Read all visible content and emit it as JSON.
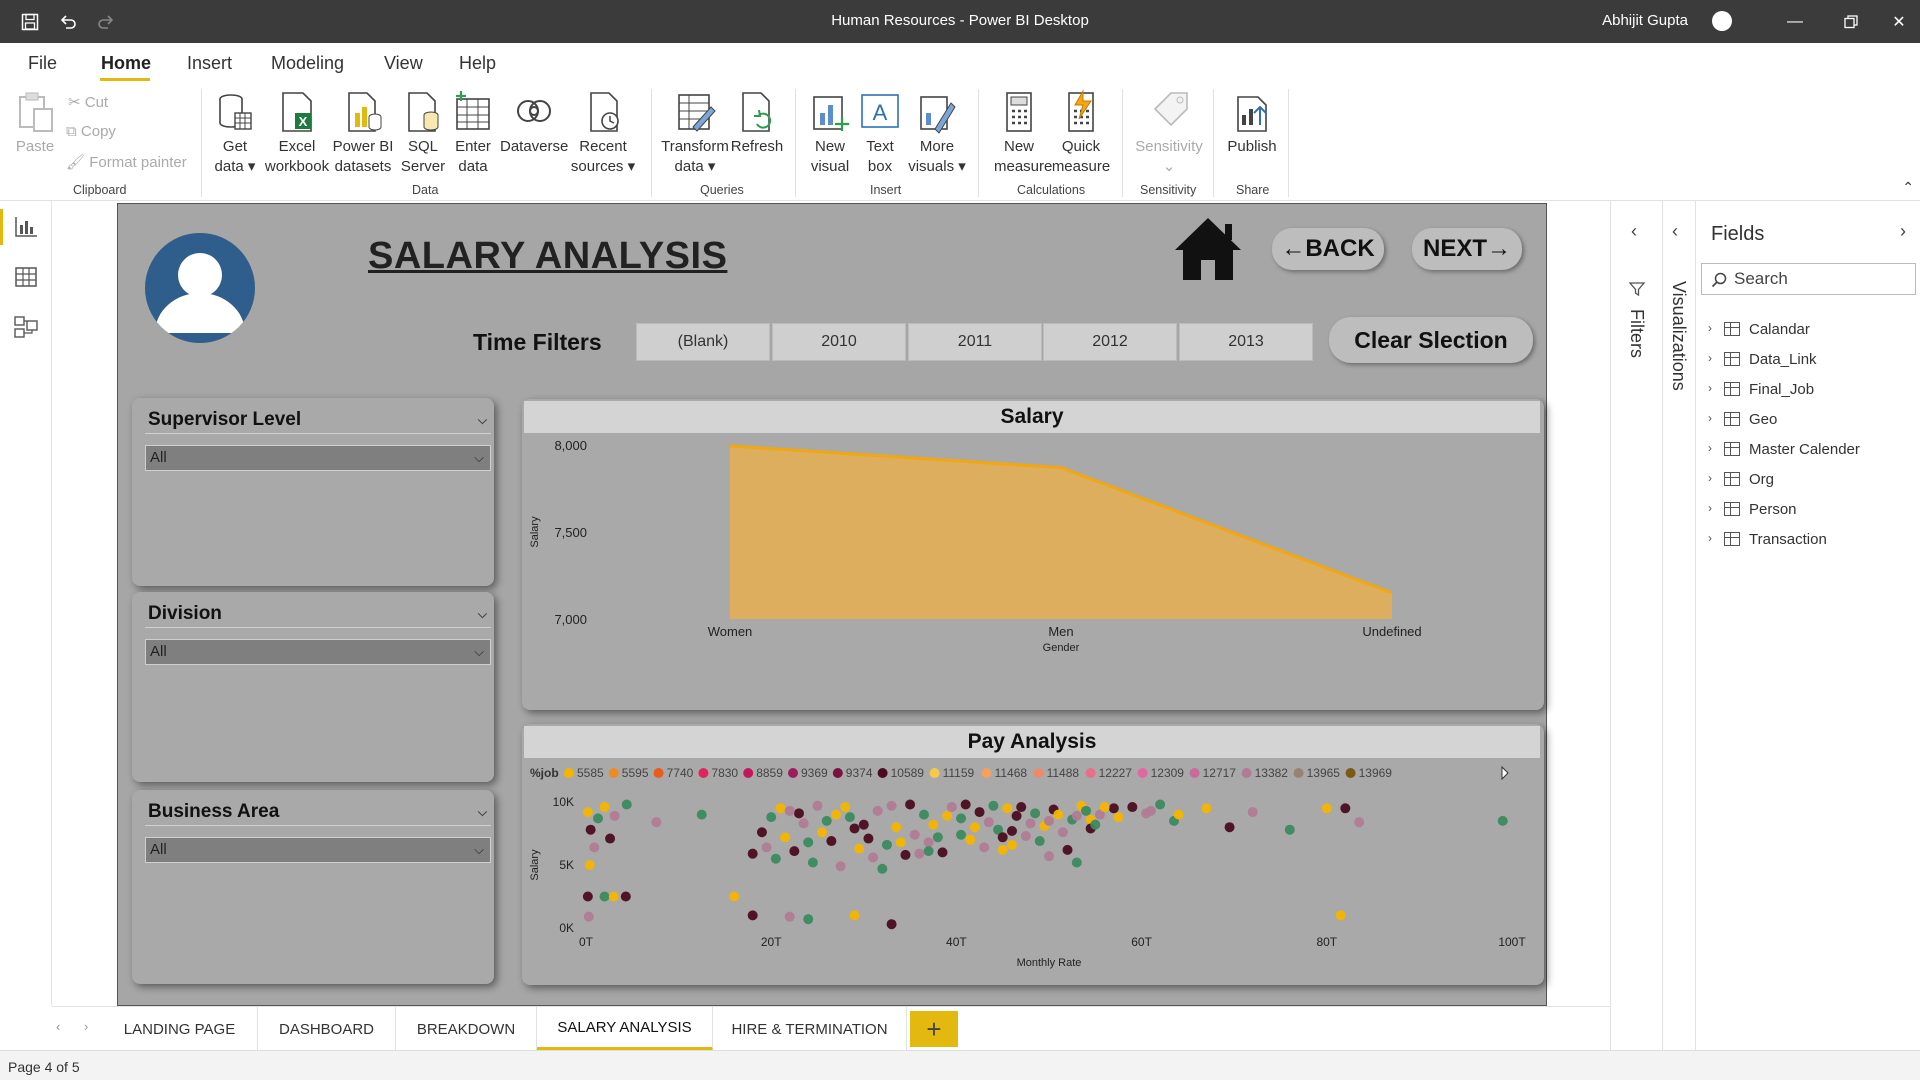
{
  "window": {
    "title": "Human Resources - Power BI Desktop",
    "user": "Abhijit Gupta"
  },
  "menu": [
    "File",
    "Home",
    "Insert",
    "Modeling",
    "View",
    "Help"
  ],
  "ribbon": {
    "clipboard": {
      "paste": "Paste",
      "cut": "Cut",
      "copy": "Copy",
      "format_painter": "Format painter",
      "label": "Clipboard"
    },
    "data": {
      "get_data": [
        "Get",
        "data ▾"
      ],
      "excel": [
        "Excel",
        "workbook"
      ],
      "pbi_datasets": [
        "Power BI",
        "datasets"
      ],
      "sql": [
        "SQL",
        "Server"
      ],
      "enter": [
        "Enter",
        "data"
      ],
      "dataverse": [
        "Dataverse",
        ""
      ],
      "recent": [
        "Recent",
        "sources ▾"
      ],
      "label": "Data"
    },
    "queries": {
      "transform": [
        "Transform",
        "data ▾"
      ],
      "refresh": [
        "Refresh",
        ""
      ],
      "label": "Queries"
    },
    "insert": {
      "new_visual": [
        "New",
        "visual"
      ],
      "text_box": [
        "Text",
        "box"
      ],
      "more_visuals": [
        "More",
        "visuals ▾"
      ],
      "label": "Insert"
    },
    "calculations": {
      "new_measure": [
        "New",
        "measure"
      ],
      "quick_measure": [
        "Quick",
        "measure"
      ],
      "label": "Calculations"
    },
    "sensitivity": {
      "btn": [
        "Sensitivity",
        "⌄"
      ],
      "label": "Sensitivity"
    },
    "share": {
      "publish": [
        "Publish",
        ""
      ],
      "label": "Share"
    }
  },
  "report": {
    "title": "SALARY ANALYSIS",
    "back": "←BACK",
    "next": "NEXT→",
    "time_filters_label": "Time Filters",
    "time_filters": [
      "(Blank)",
      "2010",
      "2011",
      "2012",
      "2013"
    ],
    "clear": "Clear Slection",
    "slicers": [
      {
        "title": "Supervisor Level",
        "value": "All"
      },
      {
        "title": "Division",
        "value": "All"
      },
      {
        "title": "Business Area",
        "value": "All"
      }
    ]
  },
  "chart_data": [
    {
      "type": "area",
      "title": "Salary",
      "categories": [
        "Women",
        "Men",
        "Undefined"
      ],
      "values": [
        7995,
        7870,
        7150
      ],
      "xlabel": "Gender",
      "ylabel": "Salary",
      "ylim": [
        7000,
        8000
      ],
      "yticks": [
        "8,000",
        "7,500",
        "7,000"
      ],
      "color": "#f2a711",
      "fill": "#dcae5e"
    },
    {
      "type": "scatter",
      "title": "Pay Analysis",
      "legend_title": "%job",
      "legend": [
        {
          "name": "5585",
          "color": "#f4b400"
        },
        {
          "name": "5595",
          "color": "#f08a24"
        },
        {
          "name": "7740",
          "color": "#e85d1c"
        },
        {
          "name": "7830",
          "color": "#e0245e"
        },
        {
          "name": "8859",
          "color": "#c2185b"
        },
        {
          "name": "9369",
          "color": "#9c1d5a"
        },
        {
          "name": "9374",
          "color": "#7a1240"
        },
        {
          "name": "10589",
          "color": "#4a0d1f"
        },
        {
          "name": "11159",
          "color": "#f7c94a"
        },
        {
          "name": "11468",
          "color": "#f2a25c"
        },
        {
          "name": "11488",
          "color": "#ee8a6a"
        },
        {
          "name": "12227",
          "color": "#e66f8a"
        },
        {
          "name": "12309",
          "color": "#e06aa0"
        },
        {
          "name": "12717",
          "color": "#c96a9b"
        },
        {
          "name": "13382",
          "color": "#b07b94"
        },
        {
          "name": "13965",
          "color": "#9a8272"
        },
        {
          "name": "13969",
          "color": "#7a5a14"
        }
      ],
      "xlabel": "Monthly Rate",
      "ylabel": "Salary",
      "xlim": [
        0,
        100
      ],
      "ylim": [
        0,
        10
      ],
      "xticks": [
        "0T",
        "20T",
        "40T",
        "60T",
        "80T",
        "100T"
      ],
      "yticks": [
        "10K",
        "5K",
        "0K"
      ],
      "points": [
        [
          0.2,
          9.2
        ],
        [
          0.5,
          7.8
        ],
        [
          0.9,
          6.4
        ],
        [
          1.3,
          8.7
        ],
        [
          2.0,
          9.6
        ],
        [
          2.6,
          7.1
        ],
        [
          3.1,
          8.9
        ],
        [
          4.4,
          9.8
        ],
        [
          0.4,
          5.0
        ],
        [
          0.2,
          2.5
        ],
        [
          0.3,
          0.9
        ],
        [
          2.0,
          2.5
        ],
        [
          3.0,
          2.5
        ],
        [
          4.3,
          2.5
        ],
        [
          7.6,
          8.4
        ],
        [
          12.5,
          9.0
        ],
        [
          16.0,
          2.5
        ],
        [
          18.0,
          1.0
        ],
        [
          22.0,
          0.9
        ],
        [
          24.0,
          0.7
        ],
        [
          29.0,
          1.0
        ],
        [
          33.0,
          0.3
        ],
        [
          37.0,
          6.8
        ],
        [
          40.5,
          7.4
        ],
        [
          45.0,
          6.2
        ],
        [
          46.0,
          7.7
        ],
        [
          50.0,
          5.7
        ],
        [
          53.0,
          5.2
        ],
        [
          54.5,
          8.6
        ],
        [
          57.0,
          9.5
        ],
        [
          61.0,
          9.3
        ],
        [
          63.5,
          8.5
        ],
        [
          67.0,
          9.5
        ],
        [
          69.5,
          8.0
        ],
        [
          72.0,
          9.2
        ],
        [
          76.0,
          7.8
        ],
        [
          80.0,
          9.5
        ],
        [
          82.0,
          9.5
        ],
        [
          83.5,
          8.4
        ],
        [
          99.0,
          8.5
        ],
        [
          81.5,
          1.0
        ],
        [
          18.0,
          5.9
        ],
        [
          19.5,
          6.4
        ],
        [
          20.5,
          5.5
        ],
        [
          21.5,
          7.2
        ],
        [
          22.5,
          6.1
        ],
        [
          23.5,
          8.3
        ],
        [
          24.5,
          5.2
        ],
        [
          25.5,
          7.6
        ],
        [
          26.5,
          6.9
        ],
        [
          27.5,
          4.9
        ],
        [
          28.5,
          8.8
        ],
        [
          29.5,
          6.3
        ],
        [
          30.5,
          7.1
        ],
        [
          31.5,
          9.3
        ],
        [
          32.5,
          6.6
        ],
        [
          33.5,
          8.0
        ],
        [
          34.5,
          5.8
        ],
        [
          35.5,
          7.4
        ],
        [
          36.5,
          9.0
        ],
        [
          37.5,
          8.2
        ],
        [
          38.5,
          6.0
        ],
        [
          39.5,
          9.6
        ],
        [
          40.5,
          8.7
        ],
        [
          41.5,
          7.0
        ],
        [
          42.5,
          9.2
        ],
        [
          43.5,
          8.4
        ],
        [
          44.5,
          7.8
        ],
        [
          45.5,
          9.5
        ],
        [
          46.5,
          8.9
        ],
        [
          47.5,
          7.3
        ],
        [
          48.5,
          9.1
        ],
        [
          49.5,
          8.1
        ],
        [
          50.5,
          9.4
        ],
        [
          51.5,
          7.6
        ],
        [
          52.5,
          8.6
        ],
        [
          53.5,
          9.7
        ],
        [
          54.5,
          7.9
        ],
        [
          55.5,
          9.0
        ],
        [
          20.0,
          8.8
        ],
        [
          21.0,
          9.5
        ],
        [
          23.0,
          9.1
        ],
        [
          25.0,
          9.7
        ],
        [
          26.0,
          8.5
        ],
        [
          28.0,
          9.6
        ],
        [
          30.0,
          8.2
        ],
        [
          31.0,
          5.6
        ],
        [
          32.0,
          4.7
        ],
        [
          34.0,
          6.8
        ],
        [
          35.0,
          9.8
        ],
        [
          36.0,
          5.9
        ],
        [
          38.0,
          7.2
        ],
        [
          39.0,
          8.9
        ],
        [
          41.0,
          9.8
        ],
        [
          43.0,
          6.4
        ],
        [
          44.0,
          9.7
        ],
        [
          46.0,
          6.6
        ],
        [
          47.0,
          9.6
        ],
        [
          48.0,
          8.3
        ],
        [
          49.0,
          6.9
        ],
        [
          51.0,
          9.0
        ],
        [
          52.0,
          6.2
        ],
        [
          53.0,
          8.9
        ],
        [
          55.0,
          8.2
        ],
        [
          56.0,
          9.6
        ],
        [
          19.0,
          7.6
        ],
        [
          22.0,
          9.3
        ],
        [
          24.0,
          6.8
        ],
        [
          27.0,
          9.0
        ],
        [
          29.0,
          7.9
        ],
        [
          33.0,
          9.7
        ],
        [
          37.0,
          6.1
        ],
        [
          42.0,
          8.0
        ],
        [
          45.0,
          7.2
        ],
        [
          50.0,
          8.5
        ],
        [
          54.0,
          9.3
        ],
        [
          57.5,
          8.8
        ],
        [
          59.0,
          9.6
        ],
        [
          60.5,
          9.1
        ],
        [
          62.0,
          9.8
        ],
        [
          64.0,
          9.0
        ]
      ]
    }
  ],
  "pages": {
    "tabs": [
      "LANDING PAGE",
      "DASHBOARD",
      "BREAKDOWN",
      "SALARY ANALYSIS",
      "HIRE & TERMINATION"
    ],
    "active_index": 3,
    "add": "+"
  },
  "status": {
    "page": "Page 4 of 5"
  },
  "panes": {
    "filters": "Filters",
    "visualizations": "Visualizations",
    "fields_title": "Fields",
    "search_placeholder": "Search",
    "tables": [
      "Calandar",
      "Data_Link",
      "Final_Job",
      "Geo",
      "Master Calender",
      "Org",
      "Person",
      "Transaction"
    ]
  }
}
